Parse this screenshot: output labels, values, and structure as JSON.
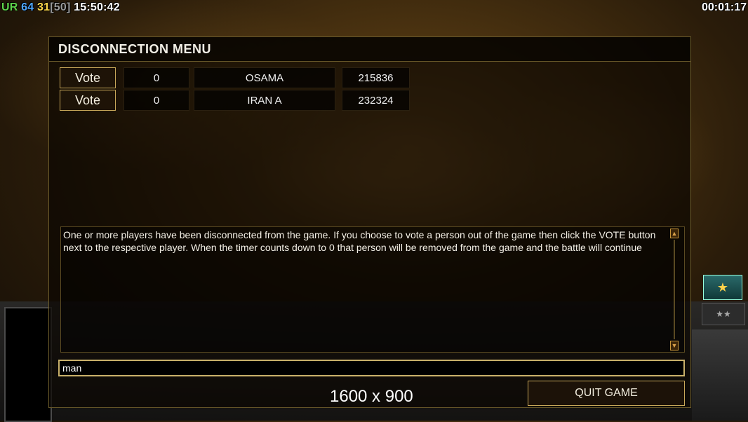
{
  "hud": {
    "ur": "UR",
    "fps": "64",
    "n31": "31",
    "n50": "[50]",
    "clock": "15:50:42",
    "game_time": "00:01:17"
  },
  "dialog": {
    "title": "DISCONNECTION MENU",
    "players": [
      {
        "vote_label": "Vote",
        "timer": "0",
        "name": "OSAMA",
        "ping": "215836"
      },
      {
        "vote_label": "Vote",
        "timer": "0",
        "name": "IRAN A",
        "ping": "232324"
      }
    ],
    "message": "One or more players have been disconnected from the game. If you choose to vote a person out of the game then click the VOTE button next to the respective player. When the timer counts down to 0 that person will be removed from the game and the battle will continue",
    "chat_value": "man",
    "resolution": "1600 x 900",
    "quit_label": "QUIT GAME"
  },
  "icons": {
    "rank": "rank-insignia-icon",
    "scroll_up": "scroll-up-icon",
    "scroll_down": "scroll-down-icon"
  }
}
